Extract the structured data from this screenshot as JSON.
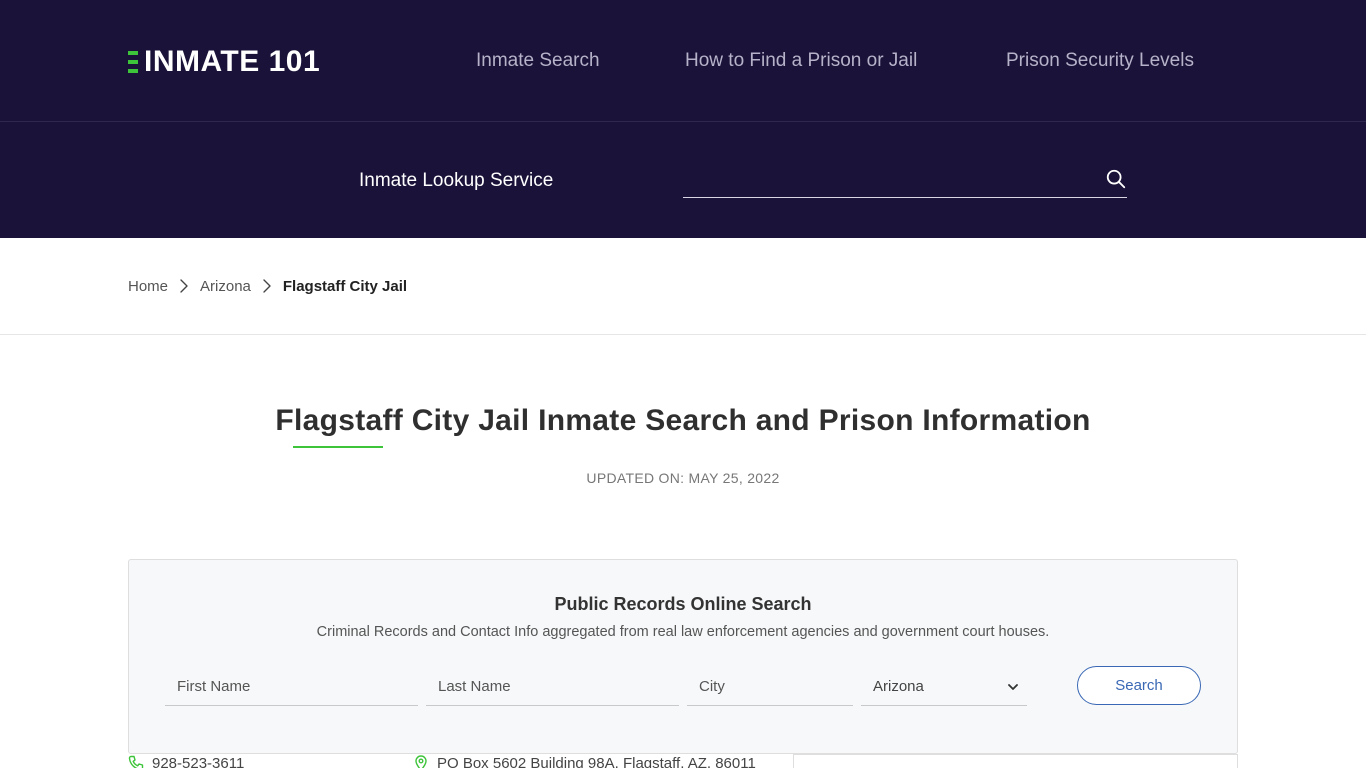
{
  "header": {
    "logo_text": "INMATE 101",
    "nav": [
      {
        "label": "Inmate Search"
      },
      {
        "label": "How to Find a Prison or Jail"
      },
      {
        "label": "Prison Security Levels"
      }
    ],
    "lookup_label": "Inmate Lookup Service",
    "lookup_placeholder": ""
  },
  "breadcrumb": {
    "items": [
      {
        "label": "Home"
      },
      {
        "label": "Arizona"
      }
    ],
    "current": "Flagstaff City Jail"
  },
  "page": {
    "title": "Flagstaff City Jail Inmate Search and Prison Information",
    "updated": "UPDATED ON: MAY 25, 2022"
  },
  "search_card": {
    "title": "Public Records Online Search",
    "subtitle": "Criminal Records and Contact Info aggregated from real law enforcement agencies and government court houses.",
    "first_name_placeholder": "First Name",
    "last_name_placeholder": "Last Name",
    "city_placeholder": "City",
    "state_selected": "Arizona",
    "button_label": "Search"
  },
  "contact": {
    "phone": "928-523-3611",
    "address": "PO Box 5602 Building 98A, Flagstaff, AZ, 86011"
  },
  "colors": {
    "header_bg": "#1a1238",
    "accent_green": "#3ec43a",
    "button_blue": "#3a68b5"
  },
  "icons": {
    "lookup": "search-icon",
    "breadcrumb_separator": "chevron-right-icon",
    "state_dropdown": "chevron-down-icon",
    "phone": "phone-icon",
    "address": "map-pin-icon"
  }
}
